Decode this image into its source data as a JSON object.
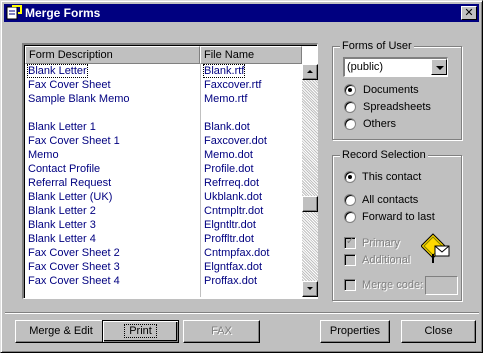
{
  "window": {
    "title": "Merge Forms"
  },
  "list": {
    "headers": [
      "Form Description",
      "File Name"
    ],
    "rows": [
      {
        "desc": "Blank Letter",
        "file": "Blank.rtf"
      },
      {
        "desc": "Fax Cover Sheet",
        "file": "Faxcover.rtf"
      },
      {
        "desc": "Sample Blank Memo",
        "file": "Memo.rtf"
      },
      {
        "desc": "",
        "file": ""
      },
      {
        "desc": "Blank Letter 1",
        "file": "Blank.dot"
      },
      {
        "desc": "Fax Cover Sheet 1",
        "file": "Faxcover.dot"
      },
      {
        "desc": "Memo",
        "file": "Memo.dot"
      },
      {
        "desc": "Contact Profile",
        "file": "Profile.dot"
      },
      {
        "desc": "Referral Request",
        "file": "Refrreq.dot"
      },
      {
        "desc": "Blank Letter (UK)",
        "file": "Ukblank.dot"
      },
      {
        "desc": "Blank Letter 2",
        "file": "Cntmpltr.dot"
      },
      {
        "desc": "Blank Letter 3",
        "file": "Elgntltr.dot"
      },
      {
        "desc": "Blank Letter 4",
        "file": "Proffltr.dot"
      },
      {
        "desc": "Fax Cover Sheet 2",
        "file": "Cntmpfax.dot"
      },
      {
        "desc": "Fax Cover Sheet 3",
        "file": "Elgntfax.dot"
      },
      {
        "desc": "Fax Cover Sheet 4",
        "file": "Proffax.dot"
      }
    ]
  },
  "forms_of_user": {
    "label": "Forms of User",
    "selected": "(public)",
    "options": [
      {
        "label": "Documents",
        "checked": true
      },
      {
        "label": "Spreadsheets",
        "checked": false
      },
      {
        "label": "Others",
        "checked": false
      }
    ]
  },
  "record_selection": {
    "label": "Record Selection",
    "options": [
      {
        "label": "This contact",
        "checked": true
      },
      {
        "label": "All contacts",
        "checked": false
      },
      {
        "label": "Forward to last",
        "checked": false
      }
    ],
    "primary": {
      "label": "Primary",
      "checked": true
    },
    "additional": {
      "label": "Additional",
      "checked": false
    },
    "merge_code": {
      "label": "Merge code:",
      "checked": false,
      "value": ""
    }
  },
  "buttons": {
    "merge_edit": "Merge & Edit",
    "print": "Print",
    "fax": "FAX",
    "properties": "Properties",
    "close": "Close"
  },
  "icons": {
    "title": "merge-forms-app-icon",
    "close": "close-icon",
    "wizard": "envelope-sign-icon"
  }
}
